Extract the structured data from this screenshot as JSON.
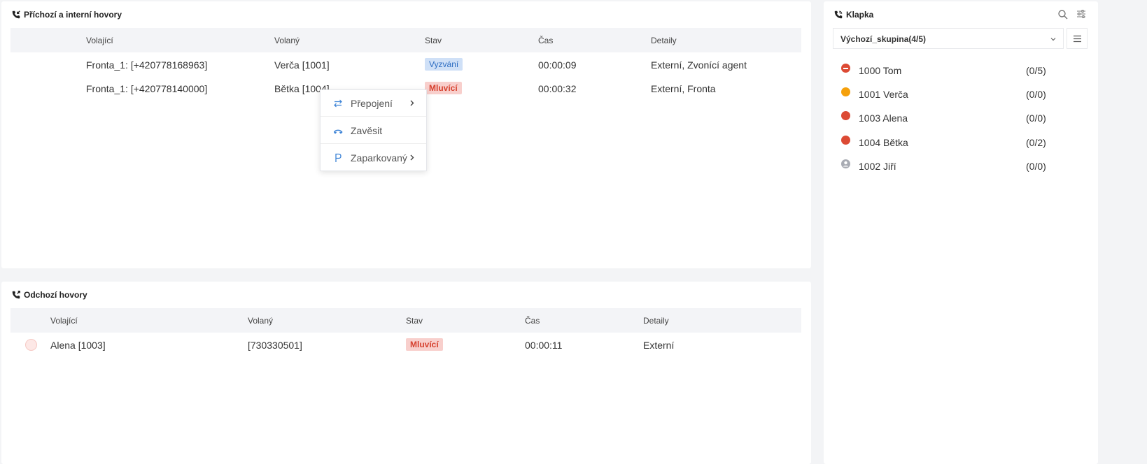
{
  "incoming": {
    "title": "Příchozí a interní hovory",
    "headers": {
      "caller": "Volající",
      "called": "Volaný",
      "state": "Stav",
      "time": "Čas",
      "details": "Detaily"
    },
    "rows": [
      {
        "caller": "Fronta_1: [+420778168963]",
        "called": "Verča [1001]",
        "state": "Vyzvání",
        "time": "00:00:09",
        "details": "Externí, Zvonící agent"
      },
      {
        "caller": "Fronta_1: [+420778140000]",
        "called": "Bětka [1004]",
        "state": "Mluvící",
        "time": "00:00:32",
        "details": "Externí, Fronta"
      }
    ]
  },
  "context_menu": {
    "items": [
      {
        "label": "Přepojení",
        "icon": "transfer-icon"
      },
      {
        "label": "Zavěsit",
        "icon": "hangup-icon"
      },
      {
        "label": "Zaparkovaný",
        "icon": "park-icon"
      }
    ]
  },
  "outgoing": {
    "title": "Odchozí hovory",
    "headers": {
      "caller": "Volající",
      "called": "Volaný",
      "state": "Stav",
      "time": "Čas",
      "details": "Detaily"
    },
    "rows": [
      {
        "caller": "Alena [1003]",
        "called": "[730330501]",
        "state": "Mluvící",
        "time": "00:00:11",
        "details": "Externí"
      }
    ]
  },
  "klapka": {
    "title": "Klapka",
    "group": "Výchozí_skupina(4/5)",
    "extensions": [
      {
        "name": "1000 Tom",
        "count": "(0/5)",
        "status": "dnd",
        "color": "#dc4a34"
      },
      {
        "name": "1001 Verča",
        "count": "(0/0)",
        "status": "ringing",
        "color": "#f5a00b"
      },
      {
        "name": "1003 Alena",
        "count": "(0/0)",
        "status": "busy",
        "color": "#dc4a34"
      },
      {
        "name": "1004 Bětka",
        "count": "(0/2)",
        "status": "busy",
        "color": "#dc4a34"
      },
      {
        "name": "1002 Jiří",
        "count": "(0/0)",
        "status": "offline",
        "color": "#a8abb3"
      }
    ]
  },
  "colors": {
    "accent": "#3b82d6",
    "ringing_bg": "#cfe0f7",
    "talking_bg": "#f8cfcc",
    "talking_text": "#d6412f"
  }
}
